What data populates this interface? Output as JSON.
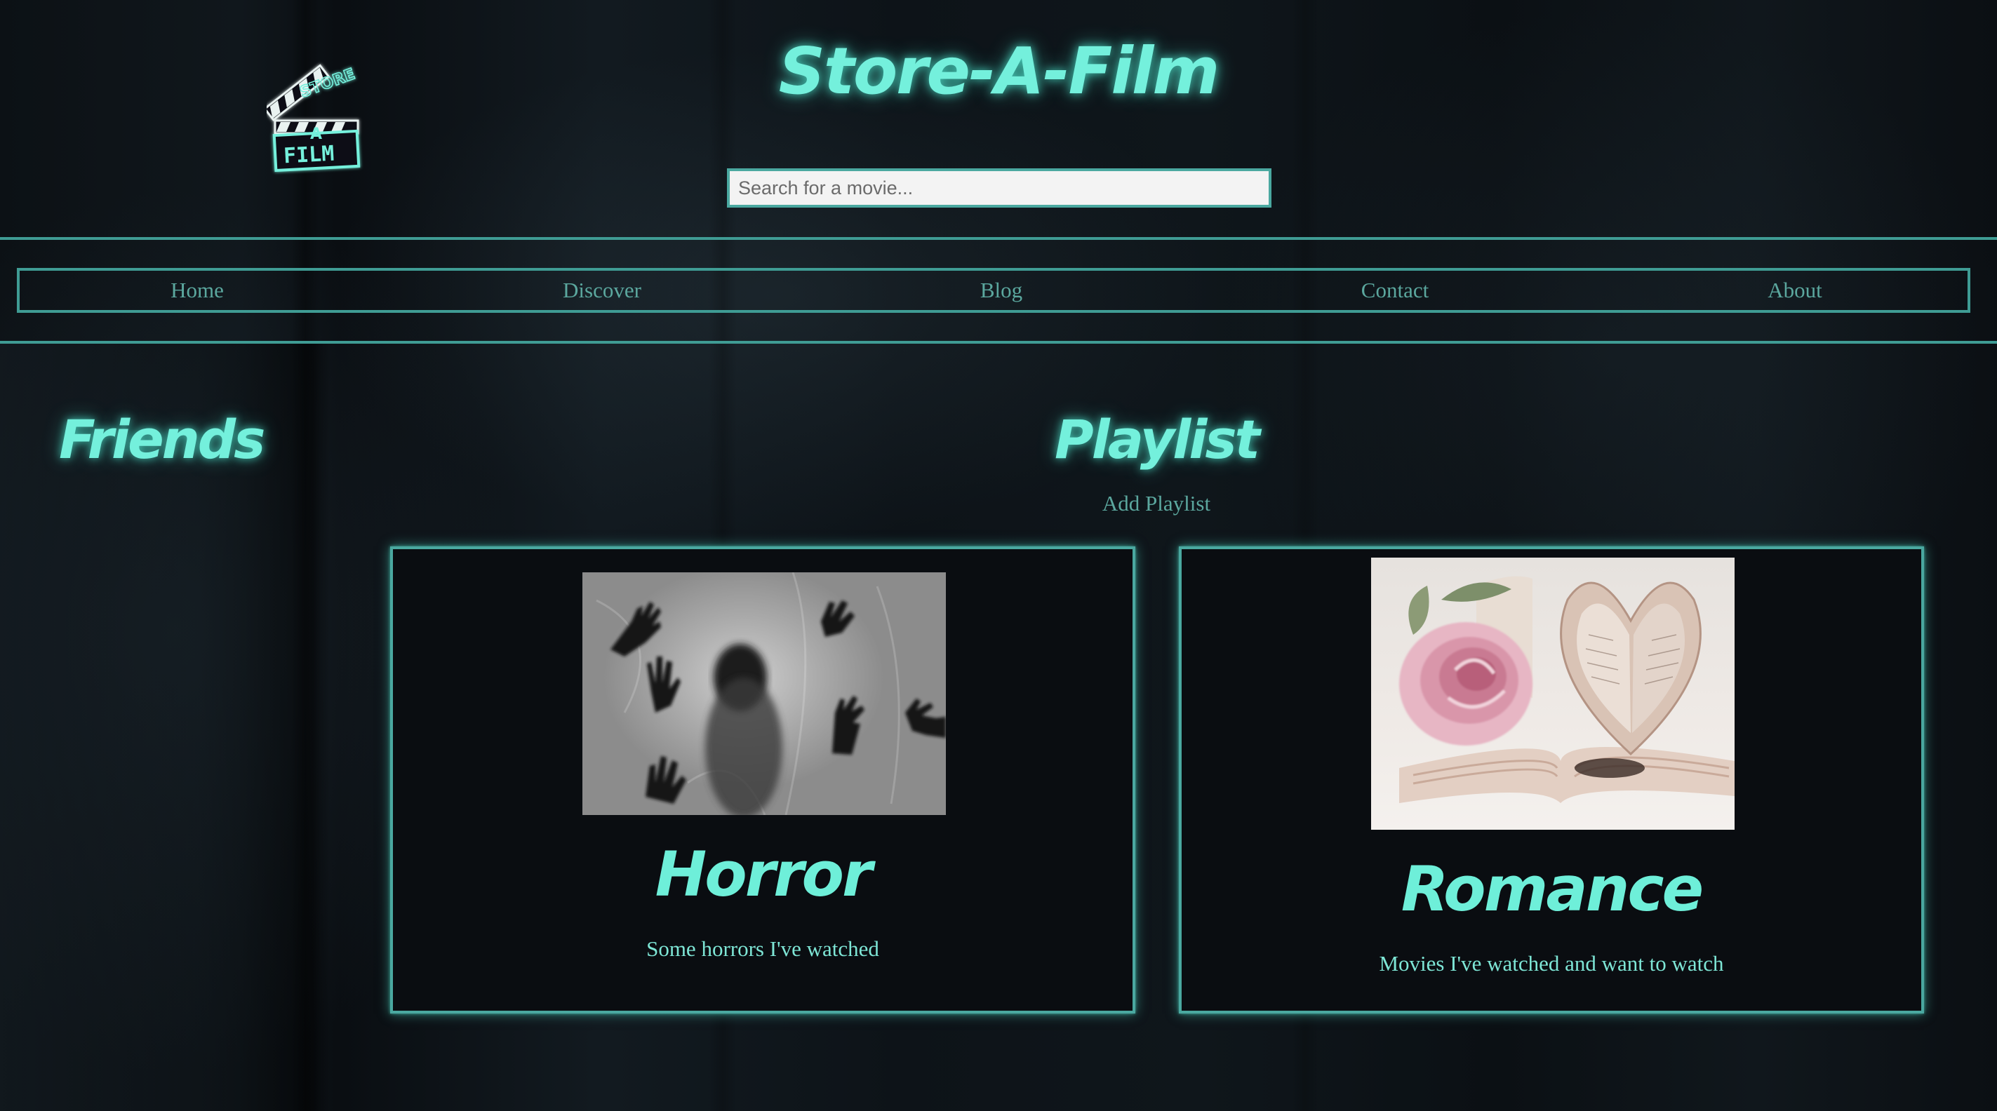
{
  "header": {
    "site_title": "Store-A-Film",
    "logo": {
      "icon": "clapperboard-icon",
      "text_top": "STORE",
      "text_mid": "A",
      "text_bottom": "FILM"
    },
    "search": {
      "placeholder": "Search for a movie...",
      "value": ""
    }
  },
  "nav": {
    "items": [
      {
        "label": "Home"
      },
      {
        "label": "Discover"
      },
      {
        "label": "Blog"
      },
      {
        "label": "Contact"
      },
      {
        "label": "About"
      }
    ]
  },
  "sidebar": {
    "title": "Friends"
  },
  "playlist": {
    "title": "Playlist",
    "add_label": "Add Playlist",
    "cards": [
      {
        "title": "Horror",
        "description": "Some horrors I've watched",
        "image": "shadow-hands-behind-sheet"
      },
      {
        "title": "Romance",
        "description": "Movies I've watched and want to watch",
        "image": "rose-and-heart-book"
      }
    ]
  },
  "colors": {
    "accent": "#74f0dc",
    "border": "#3f9c94",
    "nav_text": "#5ba79e",
    "background": "#0b0f13"
  }
}
